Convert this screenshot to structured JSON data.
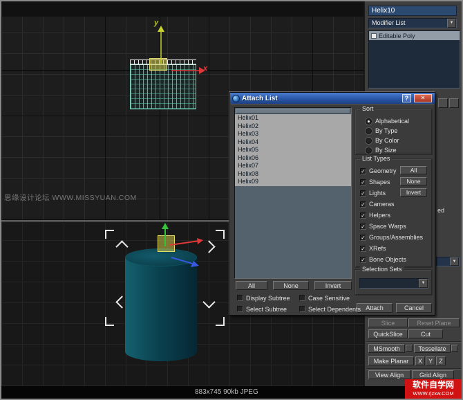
{
  "viewport": {
    "watermark": "思缘设计论坛 WWW.MISSYUAN.COM",
    "axis_labels": {
      "x": "x",
      "y": "y"
    }
  },
  "command_panel": {
    "object_name": "Helix10",
    "modifier_dropdown_label": "Modifier List",
    "stack_items": [
      "Editable Poly"
    ],
    "clipped_label": "ed",
    "tool_buttons": [
      {
        "label": "Slice",
        "enabled": false
      },
      {
        "label": "Reset Plane",
        "enabled": false
      },
      {
        "label": "QuickSlice",
        "enabled": true
      },
      {
        "label": "Cut",
        "enabled": true
      },
      {
        "label": "MSmooth",
        "enabled": true
      },
      {
        "label": "Tessellate",
        "enabled": true
      },
      {
        "label": "Make Planar",
        "enabled": true
      },
      {
        "label": "X",
        "enabled": true
      },
      {
        "label": "Y",
        "enabled": true
      },
      {
        "label": "Z",
        "enabled": true
      },
      {
        "label": "View Align",
        "enabled": true
      },
      {
        "label": "Grid Align",
        "enabled": true
      }
    ]
  },
  "dialog": {
    "title": "Attach List",
    "list_items": [
      "Helix01",
      "Helix02",
      "Helix03",
      "Helix04",
      "Helix05",
      "Helix06",
      "Helix07",
      "Helix08",
      "Helix09"
    ],
    "sort": {
      "label": "Sort",
      "options": [
        {
          "label": "Alphabetical",
          "selected": true
        },
        {
          "label": "By Type",
          "selected": false
        },
        {
          "label": "By Color",
          "selected": false
        },
        {
          "label": "By Size",
          "selected": false
        }
      ]
    },
    "list_types": {
      "label": "List Types",
      "side_buttons": [
        "All",
        "None",
        "Invert"
      ],
      "options": [
        {
          "label": "Geometry",
          "checked": true
        },
        {
          "label": "Shapes",
          "checked": true
        },
        {
          "label": "Lights",
          "checked": true
        },
        {
          "label": "Cameras",
          "checked": true
        },
        {
          "label": "Helpers",
          "checked": true
        },
        {
          "label": "Space Warps",
          "checked": true
        },
        {
          "label": "Groups/Assemblies",
          "checked": true
        },
        {
          "label": "XRefs",
          "checked": true
        },
        {
          "label": "Bone Objects",
          "checked": true
        }
      ]
    },
    "selection_sets_label": "Selection Sets",
    "list_buttons": [
      "All",
      "None",
      "Invert"
    ],
    "options": [
      {
        "label": "Display Subtree",
        "checked": false
      },
      {
        "label": "Case Sensitive",
        "checked": false
      },
      {
        "label": "Select Subtree",
        "checked": false
      },
      {
        "label": "Select Dependents",
        "checked": false
      }
    ],
    "attach_label": "Attach",
    "cancel_label": "Cancel"
  },
  "status_bar": {
    "text": "883x745  90kb  JPEG"
  },
  "badge": {
    "title": "软件自学网",
    "url": "WWW.rjzxw.COM"
  },
  "icons": {
    "dropdown_arrow": "▼",
    "close": "✕",
    "help": "?",
    "check": "✓"
  },
  "colors": {
    "title_bar": "#2a57a8",
    "close_button": "#c04a3a",
    "selection_gray": "#a8a8a8",
    "cylinder_teal": "#0b4250"
  }
}
